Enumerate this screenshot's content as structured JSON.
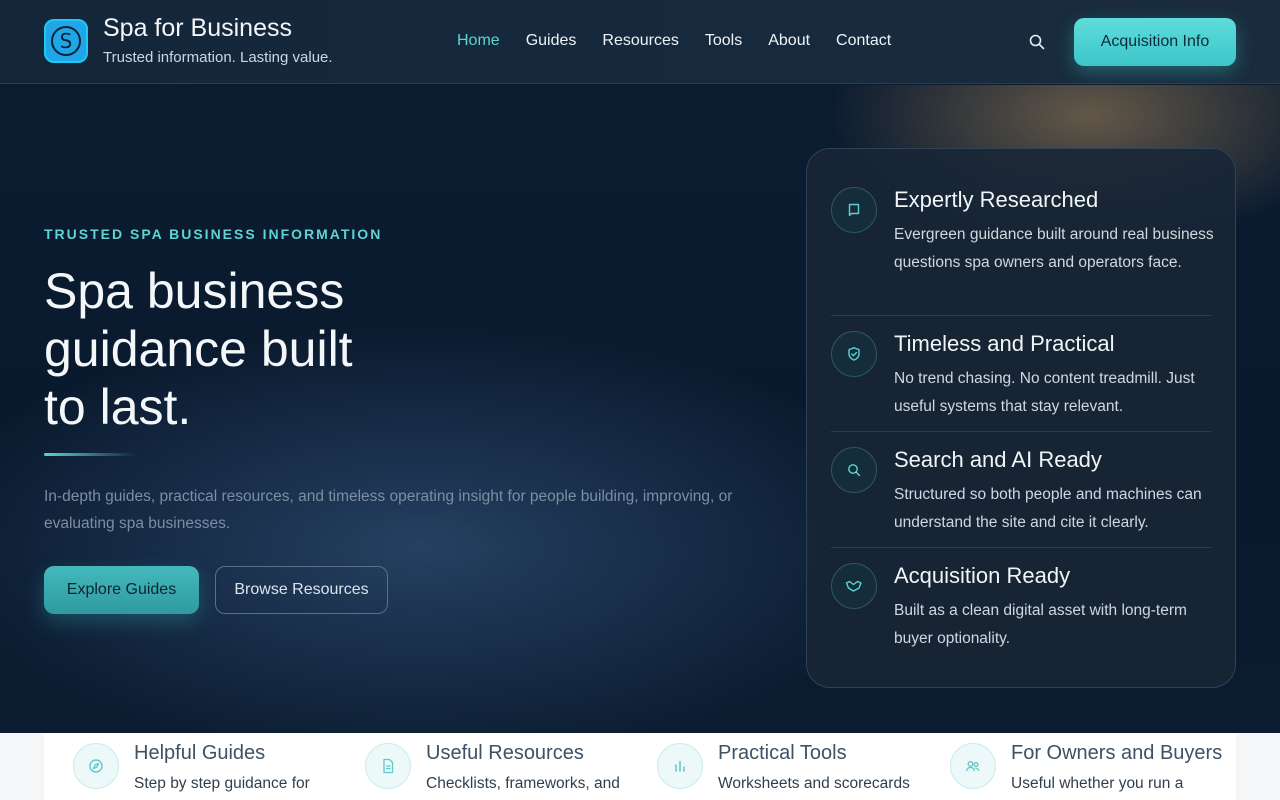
{
  "brand": {
    "title": "Spa for Business",
    "tagline": "Trusted information. Lasting value.",
    "logo_letter": "S"
  },
  "nav": {
    "items": [
      {
        "label": "Home",
        "active": true
      },
      {
        "label": "Guides"
      },
      {
        "label": "Resources"
      },
      {
        "label": "Tools"
      },
      {
        "label": "About"
      },
      {
        "label": "Contact"
      }
    ]
  },
  "header": {
    "cta_label": "Acquisition Info"
  },
  "hero": {
    "eyebrow": "TRUSTED SPA BUSINESS INFORMATION",
    "title": "Spa business guidance built to last.",
    "lead": "In-depth guides, practical resources, and timeless operating insight for people building, improving, or evaluating spa businesses.",
    "primary_button": "Explore Guides",
    "secondary_button": "Browse Resources"
  },
  "features": [
    {
      "icon": "book-icon",
      "title": "Expertly Researched",
      "text": "Evergreen guidance built around real business questions spa owners and operators face."
    },
    {
      "icon": "shield-icon",
      "title": "Timeless and Practical",
      "text": "No trend chasing. No content treadmill. Just useful systems that stay relevant."
    },
    {
      "icon": "search-icon",
      "title": "Search and AI Ready",
      "text": "Structured so both people and machines can understand the site and cite it clearly."
    },
    {
      "icon": "handshake-icon",
      "title": "Acquisition Ready",
      "text": "Built as a clean digital asset with long-term buyer optionality."
    }
  ],
  "strip": [
    {
      "icon": "compass-icon",
      "title": "Helpful Guides",
      "text": "Step by step guidance for"
    },
    {
      "icon": "document-icon",
      "title": "Useful Resources",
      "text": "Checklists, frameworks, and"
    },
    {
      "icon": "bar-chart-icon",
      "title": "Practical Tools",
      "text": "Worksheets and scorecards"
    },
    {
      "icon": "users-icon",
      "title": "For Owners and Buyers",
      "text": "Useful whether you run a"
    }
  ],
  "colors": {
    "accent": "#5fd3d4",
    "background": "#0b1a2c",
    "card": "#182636"
  }
}
